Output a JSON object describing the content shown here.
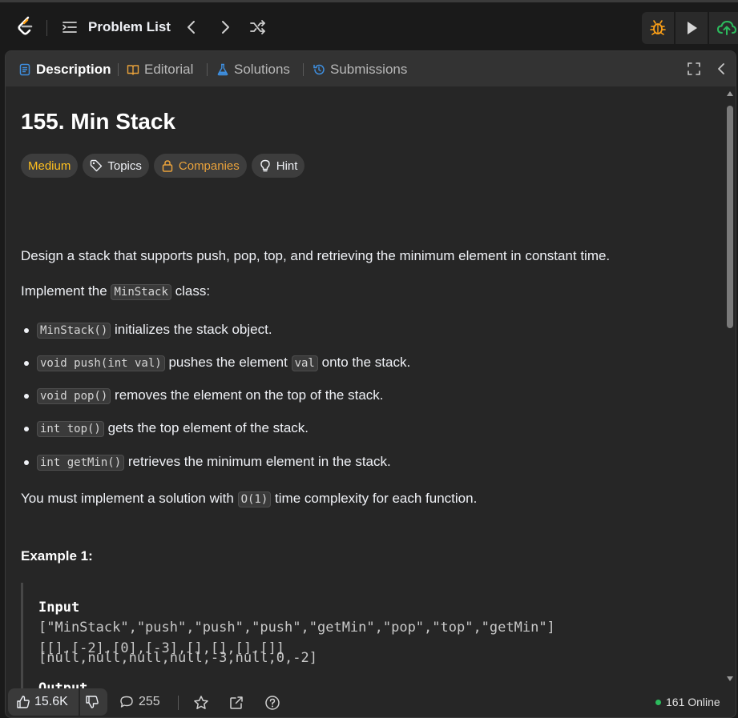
{
  "topbar": {
    "problem_list_label": "Problem List",
    "icons": [
      "leetcode-logo",
      "list-icon",
      "chevron-left-icon",
      "chevron-right-icon",
      "shuffle-icon",
      "debug-icon",
      "run-icon",
      "submit-cloud-icon"
    ]
  },
  "tabs": {
    "description": "Description",
    "editorial": "Editorial",
    "solutions": "Solutions",
    "submissions": "Submissions"
  },
  "problem": {
    "title": "155. Min Stack",
    "difficulty": "Medium",
    "topics": "Topics",
    "companies": "Companies",
    "hint": "Hint",
    "intro": "Design a stack that supports push, pop, top, and retrieving the minimum element in constant time.",
    "impl_prefix": "Implement the",
    "impl_code": "MinStack",
    "impl_suffix": "class:",
    "methods": [
      {
        "code": "MinStack()",
        "text": "initializes the stack object."
      },
      {
        "code": "void push(int val)",
        "text": "pushes the element",
        "code2": "val",
        "text2": "onto the stack."
      },
      {
        "code": "void pop()",
        "text": "removes the element on the top of the stack."
      },
      {
        "code": "int top()",
        "text": "gets the top element of the stack."
      },
      {
        "code": "int getMin()",
        "text": "retrieves the minimum element in the stack."
      }
    ],
    "complexity_prefix": "You must implement a solution with",
    "complexity_code": "O(1)",
    "complexity_suffix": "time complexity for each function.",
    "example_title": "Example 1:",
    "input_label": "Input",
    "input_line1": "[\"MinStack\",\"push\",\"push\",\"push\",\"getMin\",\"pop\",\"top\",\"getMin\"]",
    "input_line2": "[[],[-2],[0],[-3],[],[],[],[]]",
    "output_label": "Output",
    "output_line": "[null,null,null,null,-3,null,0,-2]"
  },
  "bottombar": {
    "likes": "15.6K",
    "comments": "255",
    "online": "161 Online"
  },
  "colors": {
    "medium": "#ffc01e",
    "companies": "#e9a23b",
    "online_dot": "#2cbb5d",
    "tab_description_icon": "#3e8fe0",
    "tab_editorial_icon": "#e9a23b",
    "tab_solutions_icon": "#3e8fe0",
    "tab_submissions_icon": "#3e8fe0"
  }
}
